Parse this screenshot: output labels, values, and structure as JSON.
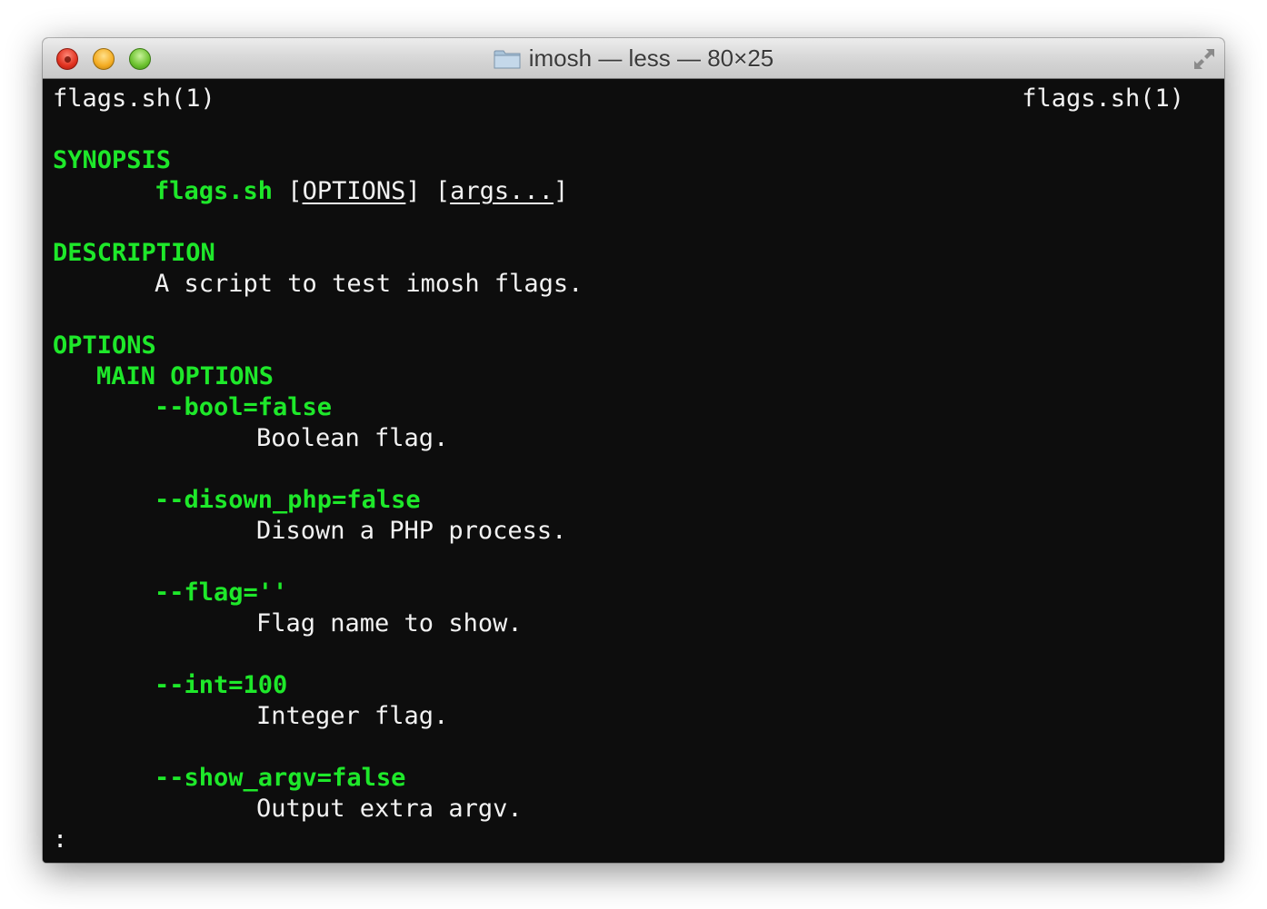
{
  "window": {
    "title": "imosh — less — 80×25",
    "title_icon": "folder-icon",
    "buttons": [
      "close",
      "minimize",
      "zoom"
    ],
    "fullscreen_icon": "fullscreen-arrows-icon"
  },
  "colors": {
    "terminal_bg": "#0d0d0d",
    "text": "#f2f2f2",
    "heading": "#1ee82a"
  },
  "man": {
    "header_left": "flags.sh(1)",
    "header_right": "flags.sh(1)",
    "synopsis_heading": "SYNOPSIS",
    "synopsis_cmd": "flags.sh",
    "synopsis_open1": " [",
    "synopsis_options": "OPTIONS",
    "synopsis_close1": "]",
    "synopsis_open2": " [",
    "synopsis_args": "args...",
    "synopsis_close2": "]",
    "description_heading": "DESCRIPTION",
    "description_text": "A script to test imosh flags.",
    "options_heading": "OPTIONS",
    "main_options_heading": "MAIN OPTIONS",
    "options": [
      {
        "flag": "--bool=false",
        "desc": "Boolean flag."
      },
      {
        "flag": "--disown_php=false",
        "desc": "Disown a PHP process."
      },
      {
        "flag": "--flag=''",
        "desc": "Flag name to show."
      },
      {
        "flag": "--int=100",
        "desc": "Integer flag."
      },
      {
        "flag": "--show_argv=false",
        "desc": "Output extra argv."
      }
    ],
    "prompt": ":"
  }
}
